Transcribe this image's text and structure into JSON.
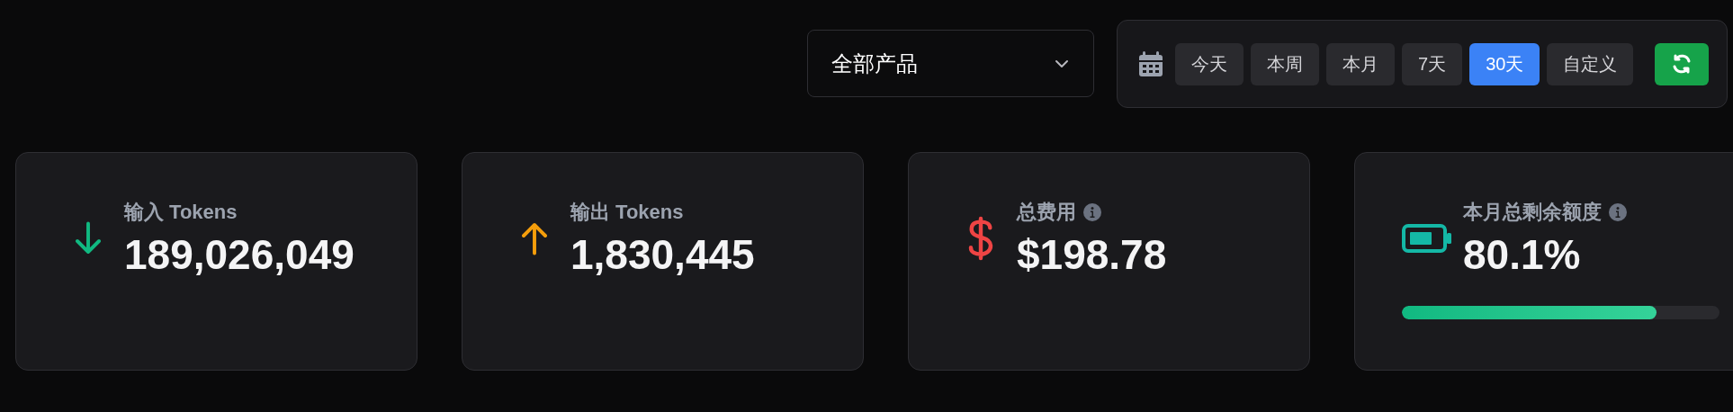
{
  "product_filter": {
    "value": "全部产品"
  },
  "date_range": {
    "options": [
      {
        "label": "今天",
        "selected": false
      },
      {
        "label": "本周",
        "selected": false
      },
      {
        "label": "本月",
        "selected": false
      },
      {
        "label": "7天",
        "selected": false
      },
      {
        "label": "30天",
        "selected": true
      },
      {
        "label": "自定义",
        "selected": false
      }
    ]
  },
  "stats": [
    {
      "kind": "input",
      "label": "输入 Tokens",
      "value": "189,026,049",
      "info": false
    },
    {
      "kind": "output",
      "label": "输出 Tokens",
      "value": "1,830,445",
      "info": false
    },
    {
      "kind": "cost",
      "label": "总费用",
      "value": "$198.78",
      "info": true
    },
    {
      "kind": "quota",
      "label": "本月总剩余额度",
      "value": "80.1%",
      "info": true,
      "level": 0.801
    }
  ]
}
